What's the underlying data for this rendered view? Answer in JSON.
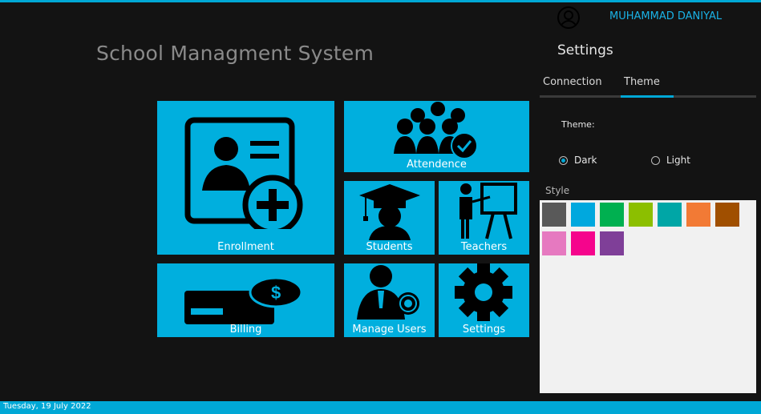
{
  "app": {
    "title": "School Managment System"
  },
  "tiles": {
    "enrollment": "Enrollment",
    "attendence": "Attendence",
    "students": "Students",
    "teachers": "Teachers",
    "billing": "Billing",
    "manage_users": "Manage Users",
    "settings": "Settings"
  },
  "user": {
    "name": "MUHAMMAD DANIYAL",
    "icon": "user-circle-icon"
  },
  "settings_panel": {
    "title": "Settings",
    "tabs": [
      {
        "label": "Connection",
        "active": false
      },
      {
        "label": "Theme",
        "active": true
      }
    ],
    "theme_label": "Theme:",
    "theme_options": [
      {
        "label": "Dark",
        "selected": true
      },
      {
        "label": "Light",
        "selected": false
      }
    ],
    "style_label": "Style",
    "swatches": [
      "#595959",
      "#00a8de",
      "#00b050",
      "#8cbf00",
      "#00a6a6",
      "#f27a35",
      "#a04f00",
      "#e679c0",
      "#f5058c",
      "#7f3f98"
    ]
  },
  "status": {
    "date": "Tuesday, 19 July 2022"
  },
  "colors": {
    "accent": "#00a8d6",
    "tile": "#00afde",
    "background": "#131313"
  }
}
